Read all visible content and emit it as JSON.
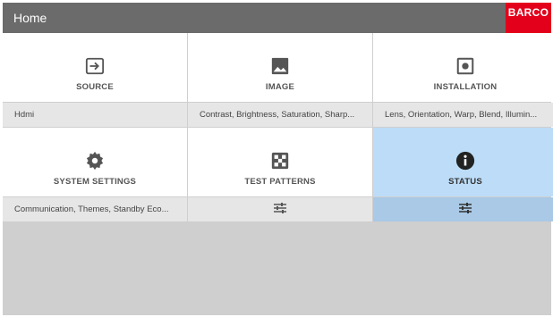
{
  "header": {
    "title": "Home",
    "logo_text": "BARCO"
  },
  "colors": {
    "header_bg": "#6b6b6b",
    "logo_bg": "#e3001b",
    "active_bg": "#bcdcf7",
    "active_sub_bg": "#a9c9e6"
  },
  "tiles": [
    {
      "label": "SOURCE",
      "icon": "source-input-icon",
      "sub": "Hdmi"
    },
    {
      "label": "IMAGE",
      "icon": "image-icon",
      "sub": "Contrast, Brightness, Saturation, Sharp..."
    },
    {
      "label": "INSTALLATION",
      "icon": "installation-icon",
      "sub": "Lens, Orientation, Warp, Blend, Illumin..."
    },
    {
      "label": "SYSTEM SETTINGS",
      "icon": "gear-icon",
      "sub": "Communication, Themes, Standby Eco..."
    },
    {
      "label": "TEST PATTERNS",
      "icon": "checkerboard-icon",
      "sub": "",
      "sub_icon": "tune-icon"
    },
    {
      "label": "STATUS",
      "icon": "info-icon",
      "sub": "",
      "sub_icon": "tune-icon",
      "selected": true
    }
  ]
}
